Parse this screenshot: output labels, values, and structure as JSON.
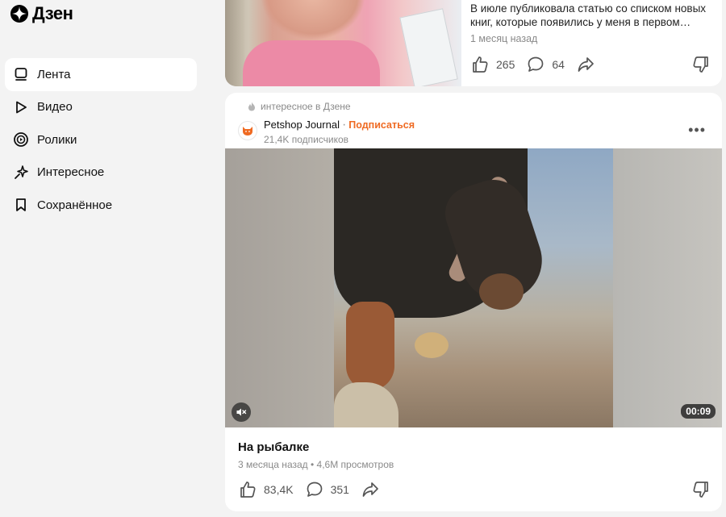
{
  "app": {
    "logo_text": "Дзен"
  },
  "sidebar": {
    "items": [
      {
        "label": "Лента",
        "icon": "feed-icon",
        "active": true
      },
      {
        "label": "Видео",
        "icon": "play-icon",
        "active": false
      },
      {
        "label": "Ролики",
        "icon": "shorts-icon",
        "active": false
      },
      {
        "label": "Интересное",
        "icon": "sparkle-icon",
        "active": false
      },
      {
        "label": "Сохранённое",
        "icon": "bookmark-icon",
        "active": false
      }
    ]
  },
  "top_card": {
    "text": "В июле публиковала статью со списком новых книг, которые появились у меня в первом…",
    "meta": "1 месяц назад",
    "likes": "265",
    "comments": "64"
  },
  "main_card": {
    "source": "интересное в Дзене",
    "publisher": "Petshop Journal",
    "subscribe_label": "Подписаться",
    "subscribers": "21,4K подписчиков",
    "duration": "00:09",
    "title": "На рыбалке",
    "meta": "3 месяца назад • 4,6M просмотров",
    "likes": "83,4K",
    "comments": "351"
  },
  "colors": {
    "accent": "#ef6a22",
    "active_bg": "#ffffff",
    "page_bg": "#f3f3f3"
  }
}
